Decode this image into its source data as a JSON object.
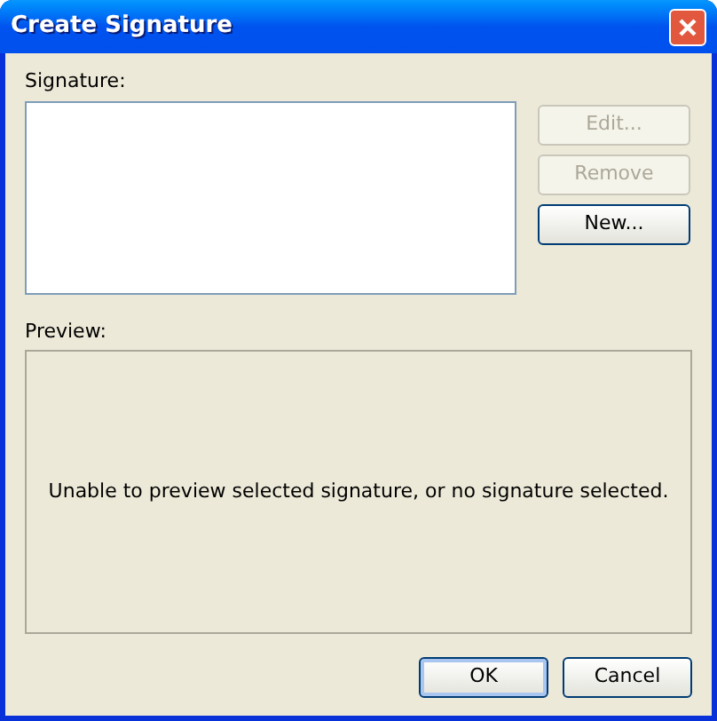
{
  "window": {
    "title": "Create Signature"
  },
  "signature_list": {
    "label": "Signature:"
  },
  "side_buttons": [
    {
      "label": "Edit...",
      "disabled": true
    },
    {
      "label": "Remove",
      "disabled": true
    },
    {
      "label": "New...",
      "disabled": false
    }
  ],
  "preview": {
    "label": "Preview:",
    "message": "Unable to preview selected signature, or no signature selected."
  },
  "buttons": [
    {
      "label": "OK",
      "default": true
    },
    {
      "label": "Cancel",
      "default": false
    }
  ]
}
